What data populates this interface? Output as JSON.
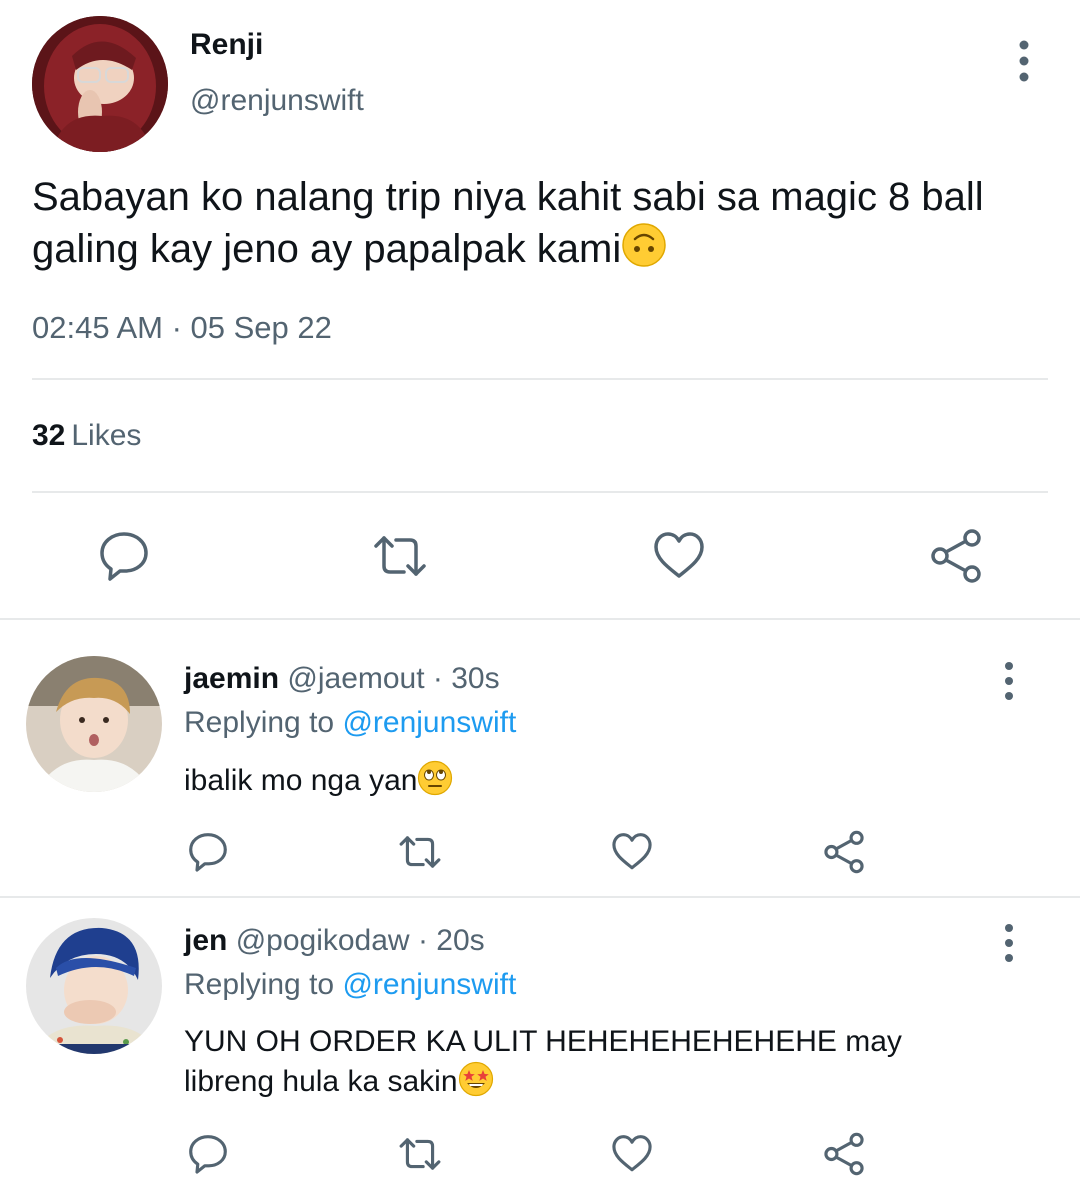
{
  "main_tweet": {
    "author_name": "Renji",
    "author_handle": "@renjunswift",
    "text": "Sabayan ko nalang trip niya kahit sabi sa magic 8 ball galing kay jeno ay papalpak kami",
    "text_emoji": "upside-down-face-emoji",
    "timestamp": "02:45 AM · 05 Sep 22",
    "likes_count": "32",
    "likes_label": "Likes",
    "actions": [
      "reply-icon",
      "retweet-icon",
      "like-icon",
      "share-icon"
    ]
  },
  "replies": [
    {
      "name": "jaemin",
      "handle": "@jaemout",
      "time": "· 30s",
      "replying_prefix": "Replying to",
      "replying_to": "@renjunswift",
      "text": "ibalik mo nga yan",
      "text_emoji": "eye-roll-emoji"
    },
    {
      "name": "jen",
      "handle": "@pogikodaw",
      "time": "· 20s",
      "replying_prefix": "Replying to",
      "replying_to": "@renjunswift",
      "text": "YUN OH ORDER KA ULIT HEHEHEHEHEHEHE may libreng hula ka sakin",
      "text_emoji": "star-struck-emoji"
    }
  ],
  "colors": {
    "text_primary": "#0f1419",
    "text_secondary": "#536471",
    "accent": "#1d9bf0",
    "divider": "#e7e9ea",
    "icon": "#536471"
  }
}
